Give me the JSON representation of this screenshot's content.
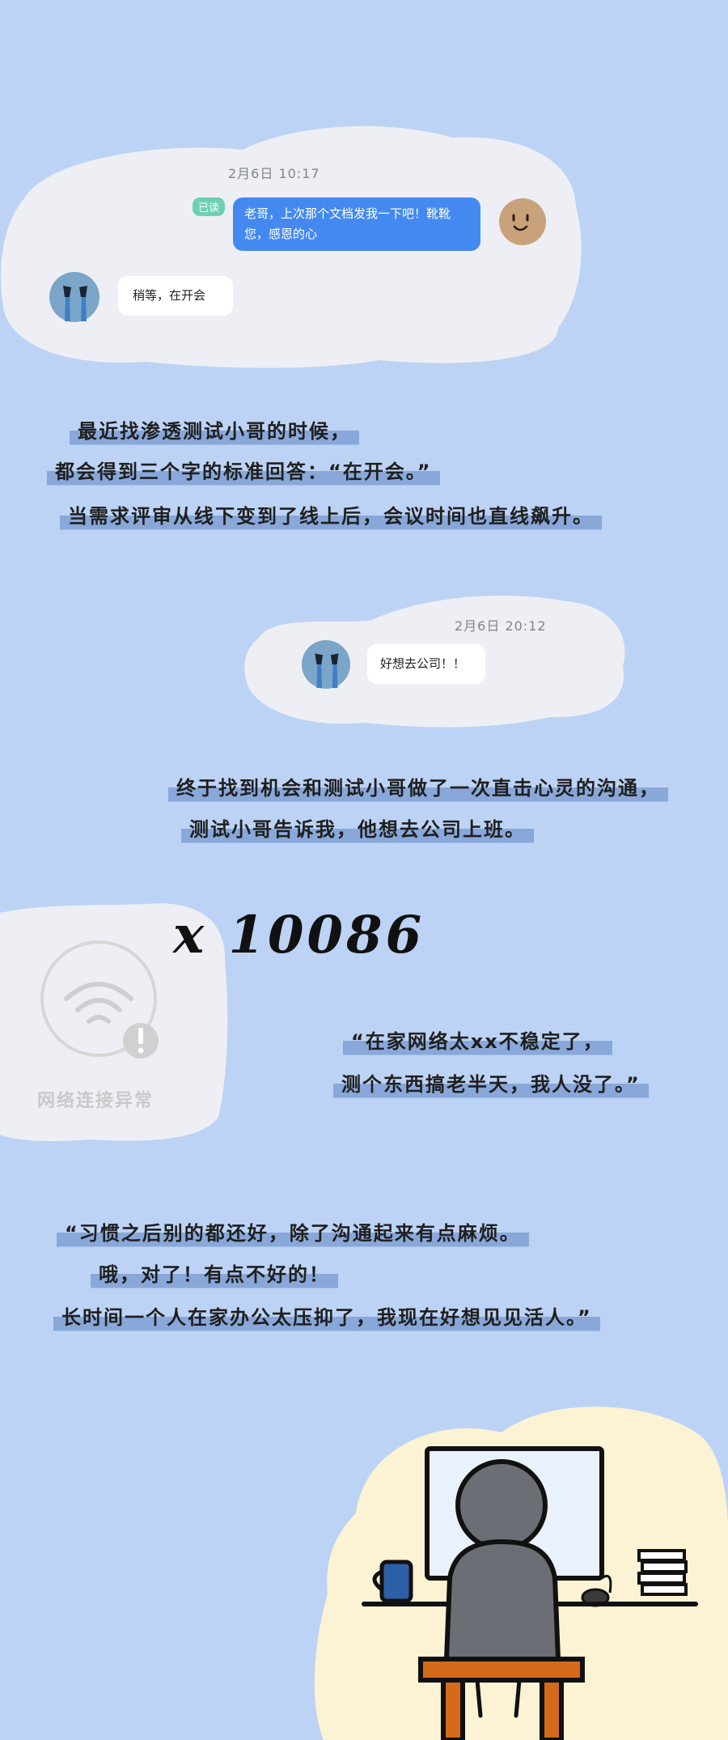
{
  "chat1": {
    "timestamp": "2月6日 10:17",
    "read_badge": "已读",
    "sent_message": "老哥，上次那个文档发我一下吧！靴靴您，感恩的心",
    "reply_message": "稍等，在开会"
  },
  "paragraph1": {
    "lines": [
      "最近找渗透测试小哥的时候，",
      "都会得到三个字的标准回答：“在开会。”",
      "当需求评审从线下变到了线上后，会议时间也直线飙升。"
    ]
  },
  "chat2": {
    "timestamp": "2月6日 20:12",
    "message": "好想去公司！！"
  },
  "paragraph2": {
    "lines": [
      "终于找到机会和测试小哥做了一次直击心灵的沟通，",
      "测试小哥告诉我，他想去公司上班。"
    ]
  },
  "network_card": {
    "error_label": "网络连接异常",
    "multiplier": "x 10086"
  },
  "quote1": {
    "lines": [
      "“在家网络太xx不稳定了，",
      "测个东西搞老半天，我人没了。”"
    ]
  },
  "quote2": {
    "lines": [
      "“习惯之后别的都还好，除了沟通起来有点麻烦。",
      "哦，对了！有点不好的！",
      "长时间一个人在家办公太压抑了，我现在好想见见活人。”"
    ]
  },
  "colors": {
    "background": "#bcd3f5",
    "cloud": "#eeeff4",
    "blue_bubble": "#4489f0",
    "read_badge": "#6fcfb6",
    "highlight": "#89a8d9",
    "desk_orange": "#d46a1a",
    "figure_gray": "#6b6f75",
    "yellow_blob": "#fbf3d3"
  }
}
